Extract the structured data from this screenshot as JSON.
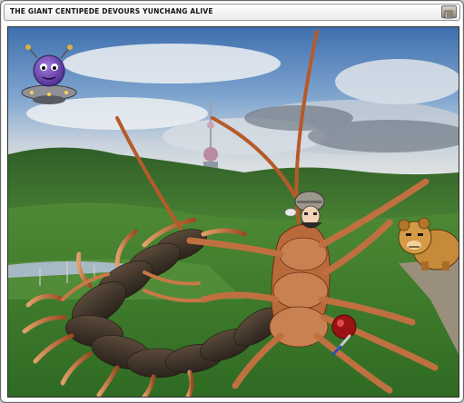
{
  "window": {
    "title": "THE GIANT CENTIPEDE DEVOURS YUNCHANG ALIVE",
    "icon": "restore-icon"
  },
  "scene": {
    "background": "grassland-valley-photo",
    "sprites": [
      "ufo-robot-sprite",
      "bear-sprite",
      "knight-sprite",
      "bomb-sprite"
    ],
    "creature": "giant-centipede",
    "colors": {
      "sky": "#4b78b4",
      "grass": "#3f7a2e",
      "centipede": "#b45a2d"
    }
  }
}
